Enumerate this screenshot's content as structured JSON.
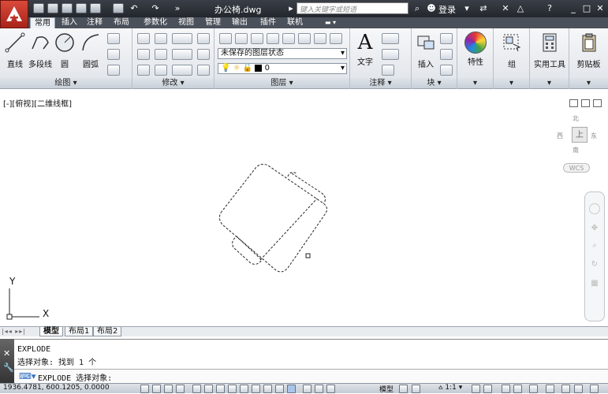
{
  "title_bar": {
    "document_title": "办公椅.dwg",
    "search_placeholder": "键入关键字或短语",
    "login_label": "登录"
  },
  "ribbon_tabs": [
    "常用",
    "插入",
    "注释",
    "布局",
    "参数化",
    "视图",
    "管理",
    "输出",
    "插件",
    "联机"
  ],
  "active_tab": "常用",
  "draw_panel": {
    "label": "绘图",
    "tools": [
      "直线",
      "多段线",
      "圆",
      "圆弧"
    ]
  },
  "modify_panel": {
    "label": "修改"
  },
  "layers_panel": {
    "label": "图层",
    "layer_state": "未保存的图层状态",
    "current_layer": "0"
  },
  "annotation_panel": {
    "label": "注释",
    "text_tool": "文字"
  },
  "block_panel": {
    "label": "块",
    "insert_tool": "插入"
  },
  "properties_panel": {
    "label": "特性"
  },
  "groups_panel": {
    "label": "组"
  },
  "utilities_panel": {
    "label": "实用工具"
  },
  "clipboard_panel": {
    "label": "剪贴板"
  },
  "viewport": {
    "label": "[-][俯视][二维线框]",
    "viewcube": {
      "north": "北",
      "south": "南",
      "west": "西",
      "east": "东",
      "top": "上",
      "wcs": "WCS"
    },
    "ucs": {
      "x": "X",
      "y": "Y"
    }
  },
  "layout_tabs": [
    "模型",
    "布局1",
    "布局2"
  ],
  "active_layout": "模型",
  "command_window": {
    "history": [
      "EXPLODE",
      "选择对象: 找到 1 个"
    ],
    "prompt": "EXPLODE 选择对象:"
  },
  "status_bar": {
    "coordinates": "1936.4781, 600.1205, 0.0000",
    "model_label": "模型",
    "scale": "1:1"
  },
  "colors": {
    "titlebar": "#2c3037",
    "app_button": "#c0352a",
    "ribbon_bg": "#e6e9ed"
  }
}
